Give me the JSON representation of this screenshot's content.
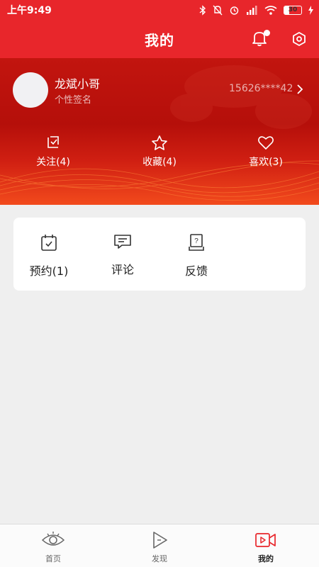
{
  "status_bar": {
    "time": "上午9:49",
    "battery": "30"
  },
  "header": {
    "title": "我的"
  },
  "profile": {
    "username": "龙斌小哥",
    "signature": "个性签名",
    "phone": "15626****42"
  },
  "stats": [
    {
      "label": "关注(4)",
      "icon": "follow-icon"
    },
    {
      "label": "收藏(4)",
      "icon": "star-icon"
    },
    {
      "label": "喜欢(3)",
      "icon": "heart-icon"
    }
  ],
  "quick_actions": [
    {
      "label": "预约(1)",
      "icon": "calendar-icon"
    },
    {
      "label": "评论",
      "icon": "comment-icon"
    },
    {
      "label": "反馈",
      "icon": "feedback-icon"
    }
  ],
  "bottom_nav": [
    {
      "label": "首页",
      "icon": "eye-home-icon",
      "active": false
    },
    {
      "label": "发现",
      "icon": "play-icon",
      "active": false
    },
    {
      "label": "我的",
      "icon": "video-camera-icon",
      "active": true
    }
  ],
  "colors": {
    "brand_red": "#e8262b",
    "active_nav": "#e8262b"
  }
}
